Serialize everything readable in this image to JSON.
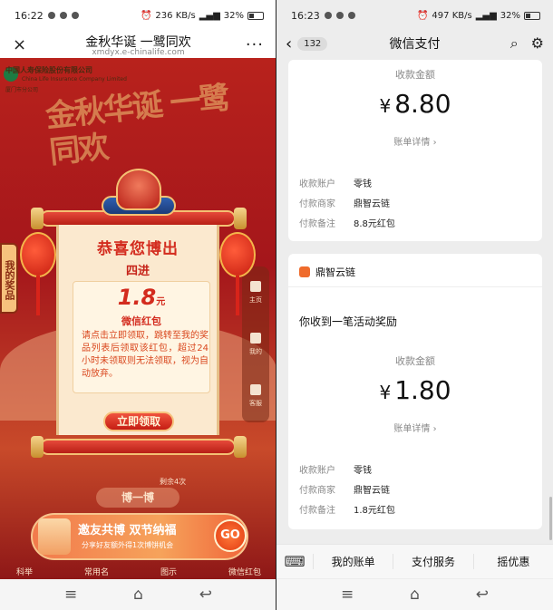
{
  "left": {
    "status": {
      "time": "16:22",
      "speed": "236 KB/s",
      "battery": "32%"
    },
    "header": {
      "title": "金秋华诞 一鹭同欢",
      "url": "xmdyx.e-chinalife.com",
      "close": "×",
      "more": "···"
    },
    "logo": {
      "line1": "中国人寿保险股份有限公司",
      "line2": "China Life Insurance Company Limited",
      "line3": "厦门市分公司"
    },
    "brush_title": "金秋华诞 一鹭同欢",
    "side_tab": "我的奖品",
    "side_nav": [
      "主页",
      "我的",
      "客服"
    ],
    "card": {
      "congrats": "恭喜您博出",
      "round": "四进",
      "amount": "1.8",
      "unit": "元",
      "packet": "微信红包",
      "desc": "请点击立即领取，跳转至我的奖品列表后领取该红包，超过24小时未领取则无法领取，视为自动放弃。",
      "claim_button": "立即领取"
    },
    "remain": "剩余4次",
    "bo_button": "博一博",
    "banner": {
      "title": "邀友共博 双节纳福",
      "subtitle": "分享好友额外得1次博饼机会",
      "go": "GO"
    },
    "bottom_tabs": [
      "科举",
      "常用名",
      "图示",
      "微信红包"
    ]
  },
  "right": {
    "status": {
      "time": "16:23",
      "speed": "497 KB/s",
      "battery": "32%"
    },
    "header": {
      "badge": "132",
      "title": "微信支付"
    },
    "card1": {
      "label": "收款金额",
      "yen": "¥",
      "amount": "8.80",
      "detail": "账单详情 ›",
      "rows": [
        {
          "k": "收款账户",
          "v": "零钱"
        },
        {
          "k": "付款商家",
          "v": "鼎智云链"
        },
        {
          "k": "付款备注",
          "v": "8.8元红包"
        }
      ]
    },
    "card2": {
      "merchant": "鼎智云链",
      "notice": "你收到一笔活动奖励",
      "label": "收款金额",
      "yen": "¥",
      "amount": "1.80",
      "detail": "账单详情 ›",
      "rows": [
        {
          "k": "收款账户",
          "v": "零钱"
        },
        {
          "k": "付款商家",
          "v": "鼎智云链"
        },
        {
          "k": "付款备注",
          "v": "1.8元红包"
        }
      ]
    },
    "bottom_menu": [
      "我的账单",
      "支付服务",
      "摇优惠"
    ]
  },
  "nav": {
    "menu": "≡",
    "home": "⌂",
    "back": "↩"
  }
}
